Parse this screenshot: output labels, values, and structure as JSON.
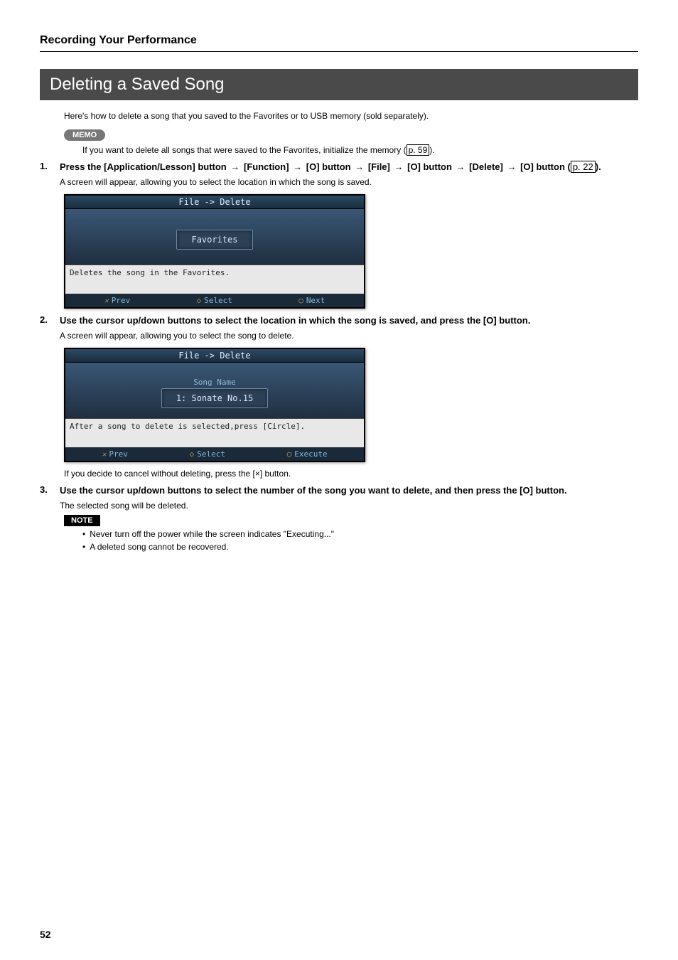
{
  "header": {
    "title": "Recording Your Performance"
  },
  "section": {
    "banner": "Deleting a Saved Song",
    "intro": "Here's how to delete a song that you saved to the Favorites or to USB memory (sold separately)."
  },
  "memo": {
    "label": "MEMO",
    "text_pre": "If you want to delete all songs that were saved to the Favorites, initialize the memory (",
    "page_ref": "p. 59",
    "text_post": ")."
  },
  "steps": {
    "s1": {
      "num": "1.",
      "pre": "Press the [Application/Lesson] button ",
      "p1": "[Function] ",
      "p2": "[O] button ",
      "p3": "[File] ",
      "p4": "[O] button ",
      "p5": "[Delete] ",
      "p6": "[O] button (",
      "page_ref": "p. 22",
      "post": ").",
      "sub": "A screen will appear, allowing you to select the location in which the song is saved."
    },
    "s2": {
      "num": "2.",
      "text": "Use the cursor up/down buttons to select the location in which the song is saved, and press the [O] button.",
      "sub": "A screen will appear, allowing you to select the song to delete."
    },
    "s2_after": "If you decide to cancel without deleting, press the [×] button.",
    "s3": {
      "num": "3.",
      "text": "Use the cursor up/down buttons to select the number of the song you want to delete, and then press the [O] button.",
      "sub": "The selected song will be deleted."
    }
  },
  "note": {
    "label": "NOTE",
    "items": [
      "Never turn off the power while the screen indicates \"Executing...\"",
      "A deleted song cannot be recovered."
    ]
  },
  "screens": {
    "s1": {
      "title": "File -> Delete",
      "button": "Favorites",
      "desc": "Deletes the song in the Favorites.",
      "foot_prev": "Prev",
      "foot_sel": "Select",
      "foot_next": "Next"
    },
    "s2": {
      "title": "File -> Delete",
      "sub": "Song Name",
      "value": "1: Sonate No.15",
      "desc": "After a song to delete is selected,press [Circle].",
      "foot_prev": "Prev",
      "foot_sel": "Select",
      "foot_exec": "Execute"
    }
  },
  "arrow": "→",
  "page_number": "52"
}
